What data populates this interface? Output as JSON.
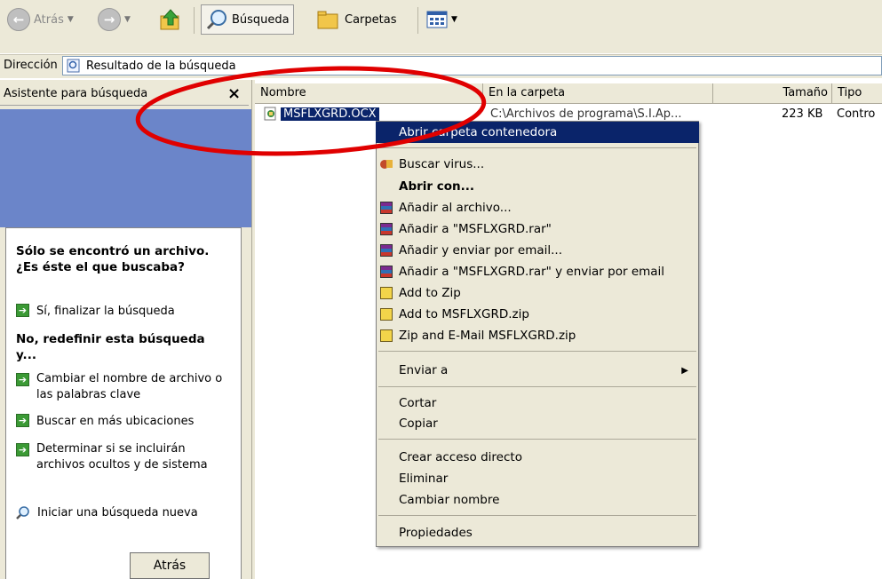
{
  "toolbar": {
    "back_label": "Atrás",
    "search_label": "Búsqueda",
    "folders_label": "Carpetas"
  },
  "address": {
    "label": "Dirección",
    "value": "Resultado de la búsqueda"
  },
  "left_pane": {
    "title": "Asistente para búsqueda",
    "close_glyph": "×",
    "found_text": "Sólo se encontró un archivo. ¿Es éste el que buscaba?",
    "option_finish": "Sí, finalizar la búsqueda",
    "refine_heading": "No, redefinir esta búsqueda y...",
    "option_rename": "Cambiar el nombre de archivo o las palabras clave",
    "option_more_locations": "Buscar en más ubicaciones",
    "option_hidden": "Determinar si se incluirán archivos ocultos y de sistema",
    "option_new_search": "Iniciar una búsqueda nueva",
    "back_button": "Atrás"
  },
  "list": {
    "columns": [
      "Nombre",
      "En la carpeta",
      "Tamaño",
      "Tipo"
    ],
    "row": {
      "name": "MSFLXGRD.OCX",
      "folder": "C:\\Archivos de programa\\S.I.Ap...",
      "size": "223 KB",
      "type": "Contro"
    }
  },
  "context_menu": {
    "items": [
      "Abrir carpeta contenedora",
      "Buscar virus...",
      "Abrir con...",
      "Añadir al archivo...",
      "Añadir a \"MSFLXGRD.rar\"",
      "Añadir y enviar por email...",
      "Añadir a \"MSFLXGRD.rar\" y enviar por email",
      "Add to Zip",
      "Add to MSFLXGRD.zip",
      "Zip and E-Mail MSFLXGRD.zip",
      "Enviar a",
      "Cortar",
      "Copiar",
      "Crear acceso directo",
      "Eliminar",
      "Cambiar nombre",
      "Propiedades"
    ]
  },
  "colors": {
    "chrome": "#ECE9D8",
    "highlight": "#0A246A",
    "task_pane_blue": "#6B85C9",
    "annotation_red": "#E00000"
  }
}
